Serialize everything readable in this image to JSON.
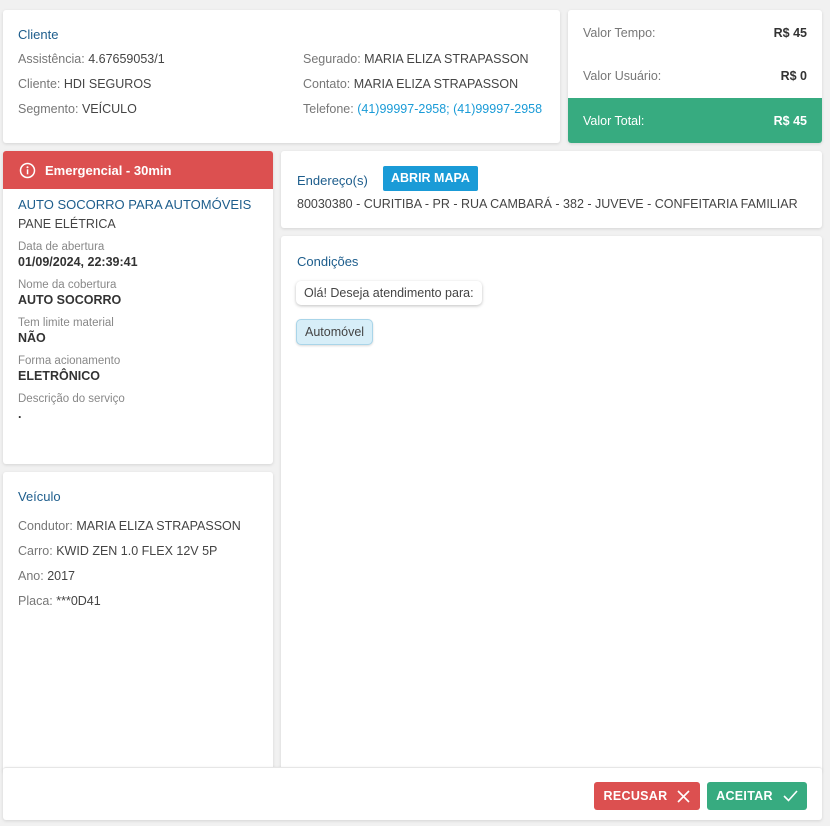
{
  "cliente": {
    "title": "Cliente",
    "assistencia_label": "Assistência:",
    "assistencia": "4.67659053/1",
    "cliente_label": "Cliente:",
    "cliente": "HDI SEGUROS",
    "segmento_label": "Segmento:",
    "segmento": "VEÍCULO",
    "segurado_label": "Segurado:",
    "segurado": "MARIA ELIZA STRAPASSON",
    "contato_label": "Contato:",
    "contato": "MARIA ELIZA STRAPASSON",
    "telefone_label": "Telefone:",
    "telefone": "(41)99997-2958; (41)99997-2958"
  },
  "valores": {
    "tempo_label": "Valor Tempo:",
    "tempo": "R$ 45",
    "usuario_label": "Valor Usuário:",
    "usuario": "R$ 0",
    "total_label": "Valor Total:",
    "total": "R$ 45"
  },
  "servico": {
    "badge": "Emergencial - 30min",
    "title": "AUTO SOCORRO PARA AUTOMÓVEIS",
    "subtitle": "PANE ELÉTRICA",
    "fields": [
      {
        "label": "Data de abertura",
        "value": "01/09/2024, 22:39:41"
      },
      {
        "label": "Nome da cobertura",
        "value": "AUTO SOCORRO"
      },
      {
        "label": "Tem limite material",
        "value": "NÃO"
      },
      {
        "label": "Forma acionamento",
        "value": "ELETRÔNICO"
      },
      {
        "label": "Descrição do serviço",
        "value": "."
      }
    ]
  },
  "veiculo": {
    "title": "Veículo",
    "condutor_label": "Condutor:",
    "condutor": "MARIA ELIZA STRAPASSON",
    "carro_label": "Carro:",
    "carro": "KWID ZEN 1.0 FLEX 12V 5P",
    "ano_label": "Ano:",
    "ano": "2017",
    "placa_label": "Placa:",
    "placa": "***0D41"
  },
  "endereco": {
    "title": "Endereço(s)",
    "map_button": "ABRIR MAPA",
    "address": "80030380 - CURITIBA - PR - RUA CAMBARÁ - 382 - JUVEVE - CONFEITARIA FAMILIAR"
  },
  "condicoes": {
    "title": "Condições",
    "question": "Olá! Deseja atendimento para:",
    "answer": "Automóvel"
  },
  "actions": {
    "reject": "RECUSAR",
    "accept": "ACEITAR"
  },
  "colors": {
    "accent": "#1d5d8c",
    "success": "#37ab80",
    "danger": "#dc5050",
    "link": "#1a9bd7"
  }
}
